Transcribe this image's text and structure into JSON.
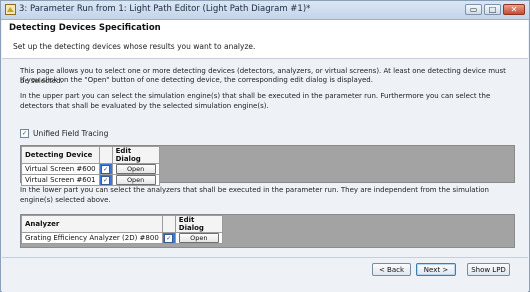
{
  "window": {
    "title": "3: Parameter Run from 1: Light Path Editor (Light Path Diagram #1)*",
    "controls": {
      "minimize": "▭",
      "maximize": "□",
      "close": "✕"
    }
  },
  "header": {
    "title": "Detecting Devices Specification",
    "subtitle": "Set up the detecting devices whose results you want to analyze."
  },
  "intro": {
    "line1": "This page allows you to select one or more detecting devices (detectors, analyzers, or virtual screens). At least one detecting device must be selected.",
    "line2": "If you click on the \"Open\" button of one detecting device, the corresponding edit dialog is displayed.",
    "line3": "In the upper part you can select the simulation engine(s) that shall be executed in the parameter run. Furthermore you can select the detectors that shall be evaluated by the selected simulation engine(s)."
  },
  "unified": {
    "label": "Unified Field Tracing",
    "checked": true,
    "check_glyph": "✓"
  },
  "devices_table": {
    "headers": {
      "device": "Detecting Device",
      "edit": "Edit Dialog"
    },
    "rows": [
      {
        "name": "Virtual Screen #600",
        "checked": true,
        "button": "Open"
      },
      {
        "name": "Virtual Screen #601",
        "checked": true,
        "button": "Open"
      }
    ]
  },
  "lower_text": "In the lower part you can select the analyzers that shall be executed in the parameter run. They are independent from the simulation engine(s) selected above.",
  "analyzer_table": {
    "headers": {
      "analyzer": "Analyzer",
      "edit": "Edit Dialog"
    },
    "rows": [
      {
        "name": "Grating Efficiency Analyzer (2D) #800",
        "checked": true,
        "button": "Open"
      }
    ]
  },
  "footer": {
    "back": "< Back",
    "next": "Next >",
    "show_lpd": "Show LPD"
  },
  "colors": {
    "selected_cell": "#3b78d8",
    "grid_bg": "#a3a3a3",
    "panel_bg": "#eef2f7"
  }
}
